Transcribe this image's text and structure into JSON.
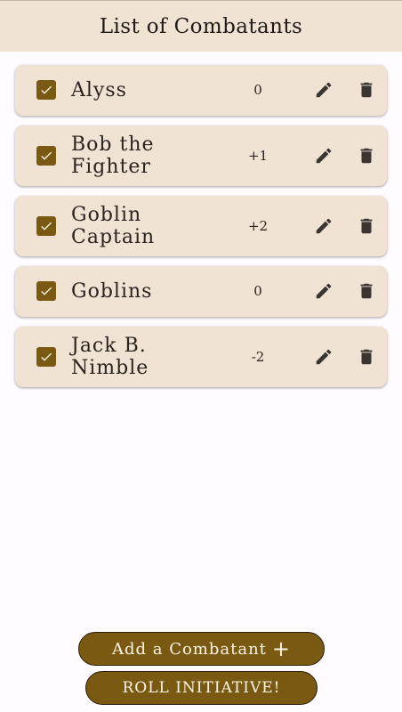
{
  "header": {
    "title": "List of Combatants"
  },
  "combatants": [
    {
      "name": "Alyss",
      "modifier": "0",
      "checked": true
    },
    {
      "name": "Bob the Fighter",
      "modifier": "+1",
      "checked": true
    },
    {
      "name": "Goblin Captain",
      "modifier": "+2",
      "checked": true
    },
    {
      "name": "Goblins",
      "modifier": "0",
      "checked": true
    },
    {
      "name": "Jack B. Nimble",
      "modifier": "-2",
      "checked": true
    }
  ],
  "actions": {
    "add_label": "Add a Combatant",
    "add_icon": "+",
    "roll_label": "ROLL INITIATIVE!"
  },
  "colors": {
    "app_bar": "#f1e3d4",
    "card": "#f1e3d4",
    "accent": "#7a5a12",
    "background": "#fffbfe",
    "icon": "#3b3531"
  },
  "icons": {
    "checkbox": "checkbox-checked-icon",
    "edit": "pencil-icon",
    "delete": "trash-icon"
  }
}
